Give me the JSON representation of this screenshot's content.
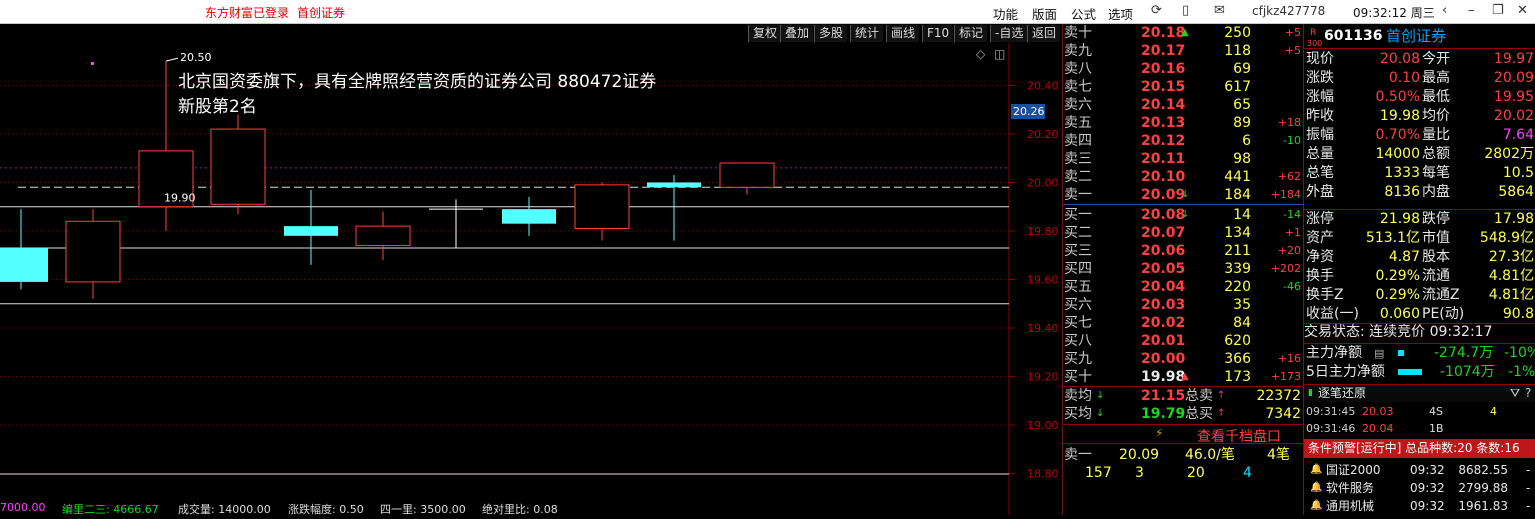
{
  "topbar": {
    "status": "东方财富已登录",
    "broker": "首创证券",
    "menu": [
      "功能",
      "版面",
      "公式",
      "选项"
    ],
    "account": "cfjkz427778",
    "time": "09:32:12 周三"
  },
  "toolbar": [
    "复权",
    "叠加",
    "多股",
    "统计",
    "画线",
    "F10",
    "标记",
    "-自选",
    "返回"
  ],
  "chart": {
    "annotation_line1": "北京国资委旗下，具有全牌照经营资质的证券公司  880472证券",
    "annotation_line2": "新股第2名",
    "high_label": "20.50",
    "low_label": "19.90",
    "current_price_label": "20.26",
    "yticks": [
      "20.40",
      "20.20",
      "20.00",
      "19.80",
      "19.60",
      "19.40",
      "19.20",
      "19.00",
      "18.80"
    ],
    "bottom": {
      "a": "7000.00",
      "b": "编里二三: 4666.67",
      "c": "成交量: 14000.00",
      "d": "涨跌幅度: 0.50",
      "e": "四一里: 3500.00",
      "f": "绝对里比: 0.08"
    }
  },
  "chart_data": {
    "type": "candlestick",
    "ylim": [
      18.72,
      20.55
    ],
    "candles": [
      {
        "o": 19.73,
        "c": 19.59,
        "h": 19.89,
        "l": 19.56
      },
      {
        "o": 19.59,
        "c": 19.84,
        "h": 19.89,
        "l": 19.52
      },
      {
        "o": 19.9,
        "c": 20.13,
        "h": 20.5,
        "l": 19.8
      },
      {
        "o": 19.91,
        "c": 20.22,
        "h": 20.28,
        "l": 19.87
      },
      {
        "o": 19.82,
        "c": 19.78,
        "h": 19.97,
        "l": 19.66
      },
      {
        "o": 19.74,
        "c": 19.82,
        "h": 19.88,
        "l": 19.68
      },
      {
        "o": 19.89,
        "c": 19.89,
        "h": 19.93,
        "l": 19.73
      },
      {
        "o": 19.89,
        "c": 19.83,
        "h": 19.94,
        "l": 19.78
      },
      {
        "o": 19.81,
        "c": 19.99,
        "h": 20.0,
        "l": 19.76
      },
      {
        "o": 20.0,
        "c": 19.98,
        "h": 20.03,
        "l": 19.76
      },
      {
        "o": 19.98,
        "c": 20.08,
        "h": 20.08,
        "l": 19.95
      }
    ]
  },
  "orderbook": {
    "asks": [
      {
        "label": "卖十",
        "price": "20.18",
        "arrow": "up",
        "vol": "250",
        "chg": "+5"
      },
      {
        "label": "卖九",
        "price": "20.17",
        "arrow": "",
        "vol": "118",
        "chg": "+5"
      },
      {
        "label": "卖八",
        "price": "20.16",
        "arrow": "",
        "vol": "69",
        "chg": ""
      },
      {
        "label": "卖七",
        "price": "20.15",
        "arrow": "",
        "vol": "617",
        "chg": ""
      },
      {
        "label": "卖六",
        "price": "20.14",
        "arrow": "",
        "vol": "65",
        "chg": ""
      },
      {
        "label": "卖五",
        "price": "20.13",
        "arrow": "",
        "vol": "89",
        "chg": "+18"
      },
      {
        "label": "卖四",
        "price": "20.12",
        "arrow": "",
        "vol": "6",
        "chg": "-10"
      },
      {
        "label": "卖三",
        "price": "20.11",
        "arrow": "",
        "vol": "98",
        "chg": ""
      },
      {
        "label": "卖二",
        "price": "20.10",
        "arrow": "",
        "vol": "441",
        "chg": "+62"
      },
      {
        "label": "卖一",
        "price": "20.09",
        "arrow": "down",
        "vol": "184",
        "chg": "+184"
      }
    ],
    "bids": [
      {
        "label": "买一",
        "price": "20.08",
        "arrow": "down",
        "vol": "14",
        "chg": "-14"
      },
      {
        "label": "买二",
        "price": "20.07",
        "arrow": "",
        "vol": "134",
        "chg": "+1"
      },
      {
        "label": "买三",
        "price": "20.06",
        "arrow": "",
        "vol": "211",
        "chg": "+20"
      },
      {
        "label": "买四",
        "price": "20.05",
        "arrow": "",
        "vol": "339",
        "chg": "+202"
      },
      {
        "label": "买五",
        "price": "20.04",
        "arrow": "",
        "vol": "220",
        "chg": "-46"
      },
      {
        "label": "买六",
        "price": "20.03",
        "arrow": "",
        "vol": "35",
        "chg": ""
      },
      {
        "label": "买七",
        "price": "20.02",
        "arrow": "",
        "vol": "84",
        "chg": ""
      },
      {
        "label": "买八",
        "price": "20.01",
        "arrow": "",
        "vol": "620",
        "chg": ""
      },
      {
        "label": "买九",
        "price": "20.00",
        "arrow": "",
        "vol": "366",
        "chg": "+16"
      },
      {
        "label": "买十",
        "price": "19.98",
        "arrow": "up",
        "vol": "173",
        "chg": "+173"
      }
    ],
    "summary": {
      "ask_avg_label": "卖均",
      "ask_avg": "21.15",
      "total_sell_label": "总卖",
      "total_sell": "22372",
      "bid_avg_label": "买均",
      "bid_avg": "19.79",
      "total_buy_label": "总买",
      "total_buy": "7342"
    },
    "view_thousand": "查看千档盘口",
    "detail": {
      "label": "卖一",
      "price": "20.09",
      "per": "46.0/笔",
      "count": "4笔",
      "nums": [
        "157",
        "3",
        "20",
        "4"
      ]
    }
  },
  "info": {
    "code": "601136",
    "name": "首创证券",
    "tag": "R",
    "tag2": "300",
    "rows": [
      [
        "现价",
        "20.08",
        "今开",
        "19.97"
      ],
      [
        "涨跌",
        "0.10",
        "最高",
        "20.09"
      ],
      [
        "涨幅",
        "0.50%",
        "最低",
        "19.95"
      ],
      [
        "昨收",
        "19.98",
        "均价",
        "20.02"
      ],
      [
        "振幅",
        "0.70%",
        "量比",
        "7.64"
      ],
      [
        "总量",
        "14000",
        "总额",
        "2802万"
      ],
      [
        "总笔",
        "1333",
        "每笔",
        "10.5"
      ],
      [
        "外盘",
        "8136",
        "内盘",
        "5864"
      ]
    ],
    "rows2": [
      [
        "涨停",
        "21.98",
        "跌停",
        "17.98"
      ],
      [
        "资产",
        "513.1亿",
        "市值",
        "548.9亿"
      ],
      [
        "净资",
        "4.87",
        "股本",
        "27.3亿"
      ],
      [
        "换手",
        "0.29%",
        "流通",
        "4.81亿"
      ],
      [
        "换手Z",
        "0.29%",
        "流通Z",
        "4.81亿"
      ],
      [
        "收益(一)",
        "0.060",
        "PE(动)",
        "90.8"
      ]
    ],
    "trade_status": "交易状态: 连续竞价 09:32:17",
    "main_flow_label": "主力净额",
    "main_flow": "-274.7万",
    "main_flow_pct": "-10%",
    "main5_label": "5日主力净额",
    "main5": "-1074万",
    "main5_pct": "-1%",
    "tick_title": "逐笔还原",
    "ticks": [
      [
        "09:31:45",
        "20.03",
        "4S",
        "4"
      ],
      [
        "09:31:46",
        "20.04",
        "1B",
        ""
      ]
    ],
    "alert": "条件预警[运行中] 总品种数:20 条数:16",
    "indices": [
      [
        "国证2000",
        "09:32",
        "8682.55"
      ],
      [
        "软件服务",
        "09:32",
        "2799.88"
      ],
      [
        "通用机械",
        "09:32",
        "1961.83"
      ]
    ]
  }
}
